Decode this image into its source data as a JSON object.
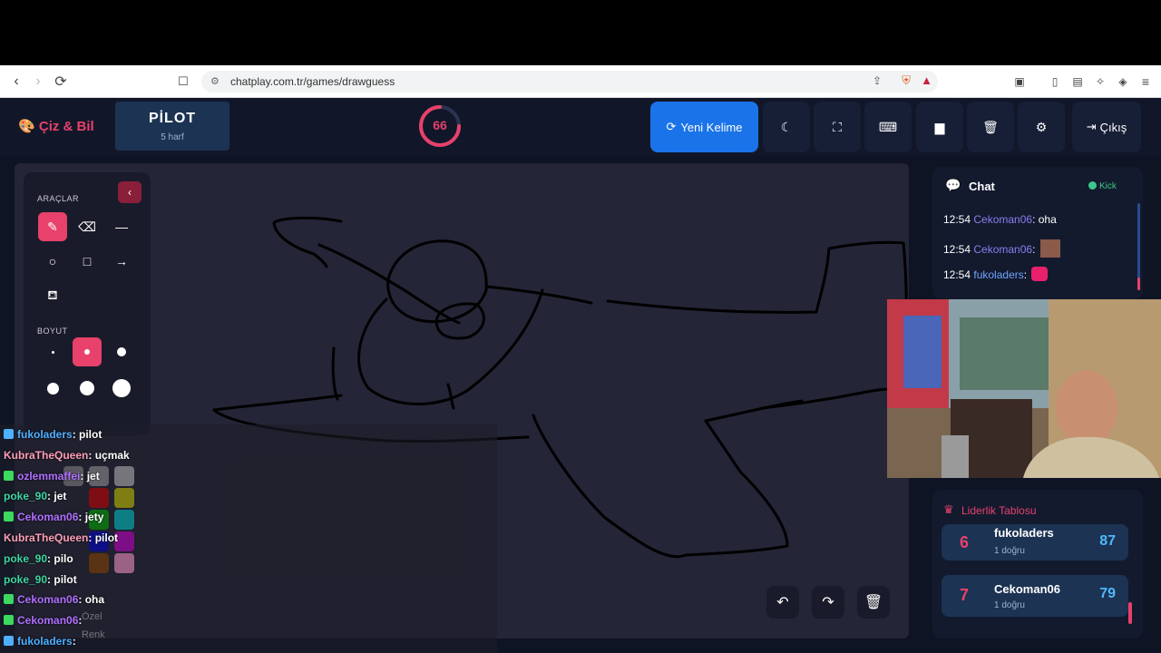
{
  "browser": {
    "url": "chatplay.com.tr/games/drawguess"
  },
  "header": {
    "brand": "Çiz & Bil",
    "word": "PİLOT",
    "word_hint": "5 harf",
    "timer": "66",
    "timer_fraction": 0.25,
    "new_word_label": "Yeni Kelime",
    "exit_label": "Çıkış"
  },
  "tools": {
    "section_tools": "ARAÇLAR",
    "section_size": "BOYUT"
  },
  "chat": {
    "title": "Chat",
    "kick_label": "Kick",
    "messages": [
      {
        "time": "12:54",
        "user": "Cekoman06",
        "text": ": oha"
      },
      {
        "time": "12:54",
        "user": "Cekoman06",
        "text": ":"
      },
      {
        "time": "12:54",
        "user": "fukoladers",
        "text": ":"
      }
    ]
  },
  "leaderboard": {
    "title": "Liderlik Tablosu",
    "rows": [
      {
        "rank": "6",
        "name": "fukoladers",
        "sub": "1 doğru",
        "points": "87"
      },
      {
        "rank": "7",
        "name": "Cekoman06",
        "sub": "1 doğru",
        "points": "79"
      }
    ]
  },
  "overlay_chat": [
    {
      "user": "fukoladers",
      "text": ": pilot",
      "color": "#4fb0ff"
    },
    {
      "user": "KubraTheQueen",
      "text": ": uçmak",
      "color": "#ff9fb8"
    },
    {
      "user": "ozlemmaffei",
      "text": ": jet",
      "color": "#b070ff"
    },
    {
      "user": "poke_90",
      "text": ": jet",
      "color": "#3cd8a0"
    },
    {
      "user": "Cekoman06",
      "text": ": jety",
      "color": "#b070ff"
    },
    {
      "user": "KubraTheQueen",
      "text": ": pilot",
      "color": "#ff9fb8"
    },
    {
      "user": "poke_90",
      "text": ": pilo",
      "color": "#3cd8a0"
    },
    {
      "user": "poke_90",
      "text": ": pilot",
      "color": "#3cd8a0"
    },
    {
      "user": "Cekoman06",
      "text": ": oha",
      "color": "#b070ff"
    },
    {
      "user": "Cekoman06",
      "text": ":",
      "color": "#b070ff"
    },
    {
      "user": "fukoladers",
      "text": ":",
      "color": "#4fb0ff"
    }
  ],
  "overlay_faded": {
    "label_ozel": "Özel",
    "label_renk": "Renk"
  }
}
